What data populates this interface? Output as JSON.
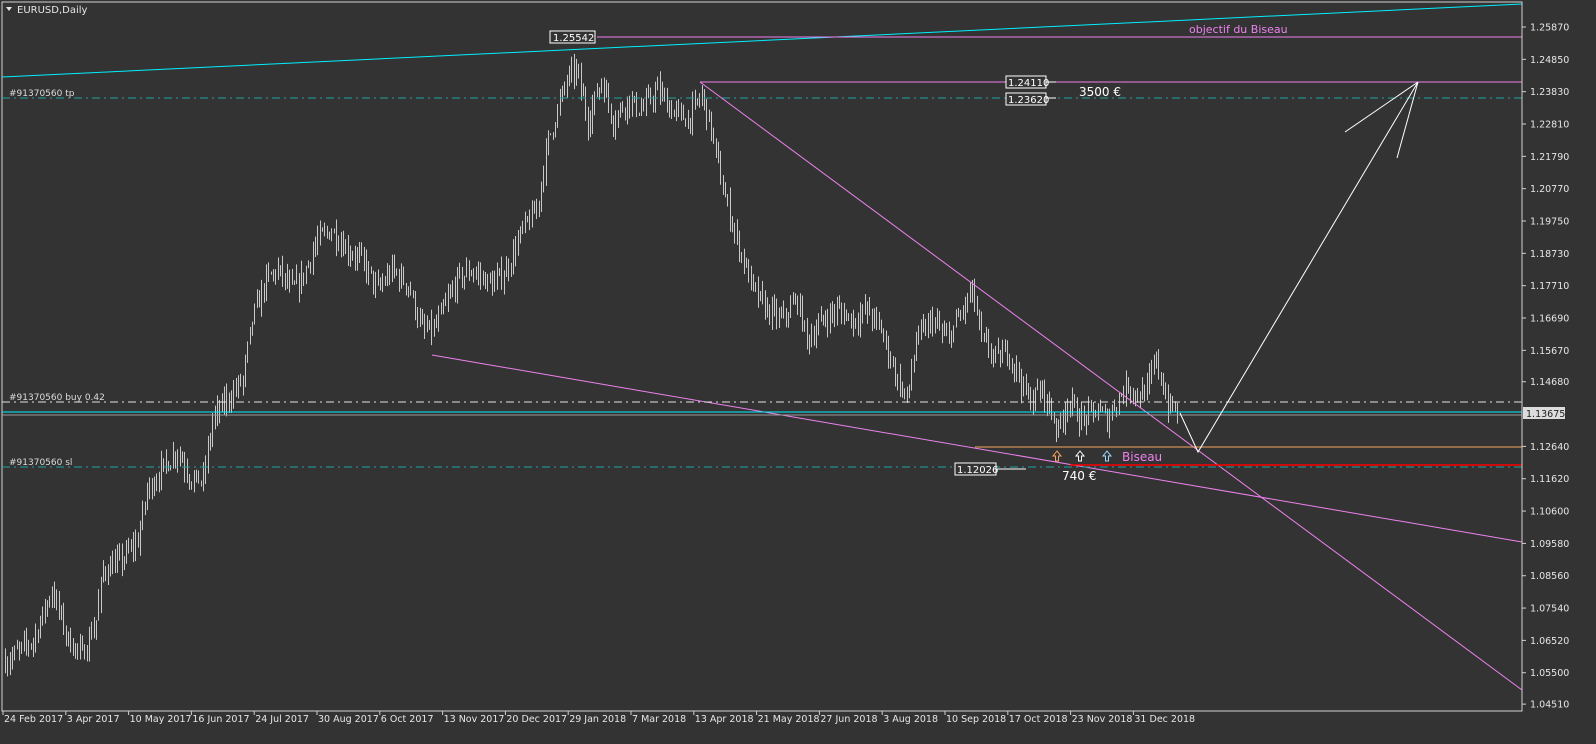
{
  "window": {
    "title": "EURUSD,Daily"
  },
  "colors": {
    "background": "#333333",
    "bars": "#c8c8c8",
    "cyan": "#00f0ff",
    "magenta": "#ee82ee",
    "teal": "#1fa0a0",
    "orange": "#f4a460",
    "red": "#ff0000",
    "white": "#ffffff"
  },
  "orders": {
    "tp_label": "#91370560 tp",
    "buy_label": "#91370560 buy 0.42",
    "sl_label": "#91370560 sl"
  },
  "annotations": {
    "top_price": "1.25542",
    "target_label": "objectif du Biseau",
    "price_1": "1.24110",
    "price_2": "1.23620",
    "profit": "3500 €",
    "low_price": "1.12026",
    "loss": "740 €",
    "pattern_label": "Biseau",
    "current_price": "1.13675"
  },
  "chart_data": {
    "type": "ohlc",
    "symbol": "EURUSD",
    "timeframe": "Daily",
    "ylim": [
      1.0451,
      1.2638
    ],
    "y_ticks": [
      "1.25870",
      "1.24850",
      "1.23830",
      "1.22810",
      "1.21790",
      "1.20770",
      "1.19750",
      "1.18730",
      "1.17710",
      "1.16690",
      "1.15670",
      "1.14680",
      "1.13675",
      "1.12640",
      "1.11620",
      "1.10600",
      "1.09580",
      "1.08560",
      "1.07540",
      "1.06520",
      "1.05500",
      "1.04510"
    ],
    "x_ticks": [
      "24 Feb 2017",
      "3 Apr 2017",
      "10 May 2017",
      "16 Jun 2017",
      "24 Jul 2017",
      "30 Aug 2017",
      "6 Oct 2017",
      "13 Nov 2017",
      "20 Dec 2017",
      "29 Jan 2018",
      "7 Mar 2018",
      "13 Apr 2018",
      "21 May 2018",
      "27 Jun 2018",
      "3 Aug 2018",
      "10 Sep 2018",
      "17 Oct 2018",
      "23 Nov 2018",
      "31 Dec 2018"
    ],
    "bars_per_x_tick": 27,
    "close_waypoints": [
      [
        1,
        1.059
      ],
      [
        12,
        1.0653
      ],
      [
        20,
        1.0811
      ],
      [
        27,
        1.0653
      ],
      [
        33,
        1.0606
      ],
      [
        39,
        1.0716
      ],
      [
        42,
        1.0874
      ],
      [
        50,
        1.0905
      ],
      [
        57,
        1.0968
      ],
      [
        61,
        1.1126
      ],
      [
        67,
        1.1189
      ],
      [
        74,
        1.1252
      ],
      [
        80,
        1.1158
      ],
      [
        85,
        1.1158
      ],
      [
        89,
        1.1347
      ],
      [
        95,
        1.141
      ],
      [
        102,
        1.1473
      ],
      [
        106,
        1.1663
      ],
      [
        112,
        1.1789
      ],
      [
        117,
        1.182
      ],
      [
        123,
        1.1757
      ],
      [
        127,
        1.1789
      ],
      [
        134,
        1.1915
      ],
      [
        140,
        1.1947
      ],
      [
        147,
        1.1883
      ],
      [
        153,
        1.1852
      ],
      [
        160,
        1.1757
      ],
      [
        166,
        1.182
      ],
      [
        173,
        1.1773
      ],
      [
        179,
        1.1631
      ],
      [
        184,
        1.1631
      ],
      [
        190,
        1.1726
      ],
      [
        194,
        1.1789
      ],
      [
        200,
        1.182
      ],
      [
        209,
        1.1773
      ],
      [
        215,
        1.182
      ],
      [
        222,
        1.1947
      ],
      [
        228,
        1.201
      ],
      [
        233,
        1.223
      ],
      [
        237,
        1.2325
      ],
      [
        241,
        1.242
      ],
      [
        245,
        1.2451
      ],
      [
        250,
        1.2294
      ],
      [
        256,
        1.242
      ],
      [
        261,
        1.2294
      ],
      [
        267,
        1.2357
      ],
      [
        273,
        1.2325
      ],
      [
        280,
        1.2388
      ],
      [
        286,
        1.2325
      ],
      [
        293,
        1.2294
      ],
      [
        299,
        1.2372
      ],
      [
        303,
        1.2262
      ],
      [
        308,
        1.2073
      ],
      [
        314,
        1.1915
      ],
      [
        321,
        1.1757
      ],
      [
        327,
        1.1694
      ],
      [
        333,
        1.1663
      ],
      [
        340,
        1.1726
      ],
      [
        344,
        1.1599
      ],
      [
        351,
        1.1663
      ],
      [
        357,
        1.1694
      ],
      [
        364,
        1.1663
      ],
      [
        370,
        1.1694
      ],
      [
        376,
        1.1631
      ],
      [
        383,
        1.1473
      ],
      [
        387,
        1.141
      ],
      [
        391,
        1.1599
      ],
      [
        398,
        1.1663
      ],
      [
        404,
        1.1599
      ],
      [
        411,
        1.1694
      ],
      [
        415,
        1.1757
      ],
      [
        419,
        1.1599
      ],
      [
        426,
        1.1536
      ],
      [
        430,
        1.1568
      ],
      [
        434,
        1.1505
      ],
      [
        439,
        1.141
      ],
      [
        445,
        1.1442
      ],
      [
        452,
        1.1316
      ],
      [
        456,
        1.141
      ],
      [
        462,
        1.1347
      ],
      [
        469,
        1.1379
      ],
      [
        473,
        1.1347
      ],
      [
        477,
        1.141
      ],
      [
        482,
        1.1458
      ],
      [
        486,
        1.1426
      ],
      [
        490,
        1.1442
      ],
      [
        494,
        1.1536
      ],
      [
        499,
        1.1394
      ],
      [
        503,
        1.1372
      ]
    ]
  }
}
